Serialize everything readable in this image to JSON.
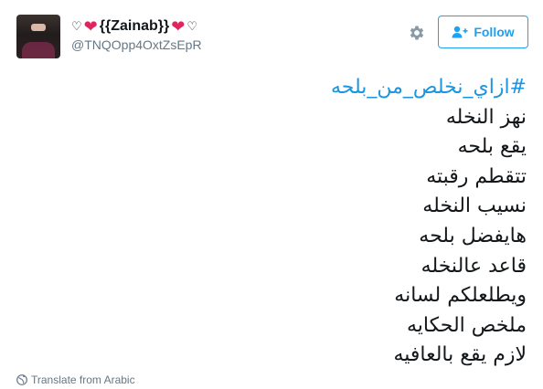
{
  "author": {
    "display_name": "{{Zainab}}",
    "screen_name": "@TNQOpp4OxtZsEpR"
  },
  "follow_button": {
    "label": "Follow"
  },
  "tweet": {
    "hashtag": "#ازاي_نخلص_من_بلحه",
    "lines": [
      "نهز النخله",
      "يقع بلحه",
      "تتقطم رقبته",
      "نسيب النخله",
      "هايفضل بلحه",
      "قاعد عالنخله",
      "ويطلعلكم لسانه",
      "ملخص الحكايه",
      "لازم يقع بالعافيه"
    ]
  },
  "translate": {
    "label": "Translate from Arabic"
  },
  "colors": {
    "accent": "#1da1f2",
    "hashtag": "#1b95e0",
    "heart": "#e0245e",
    "muted": "#657786"
  },
  "icons": [
    "gear-icon",
    "follow-person-icon",
    "globe-icon",
    "heart-icon"
  ]
}
